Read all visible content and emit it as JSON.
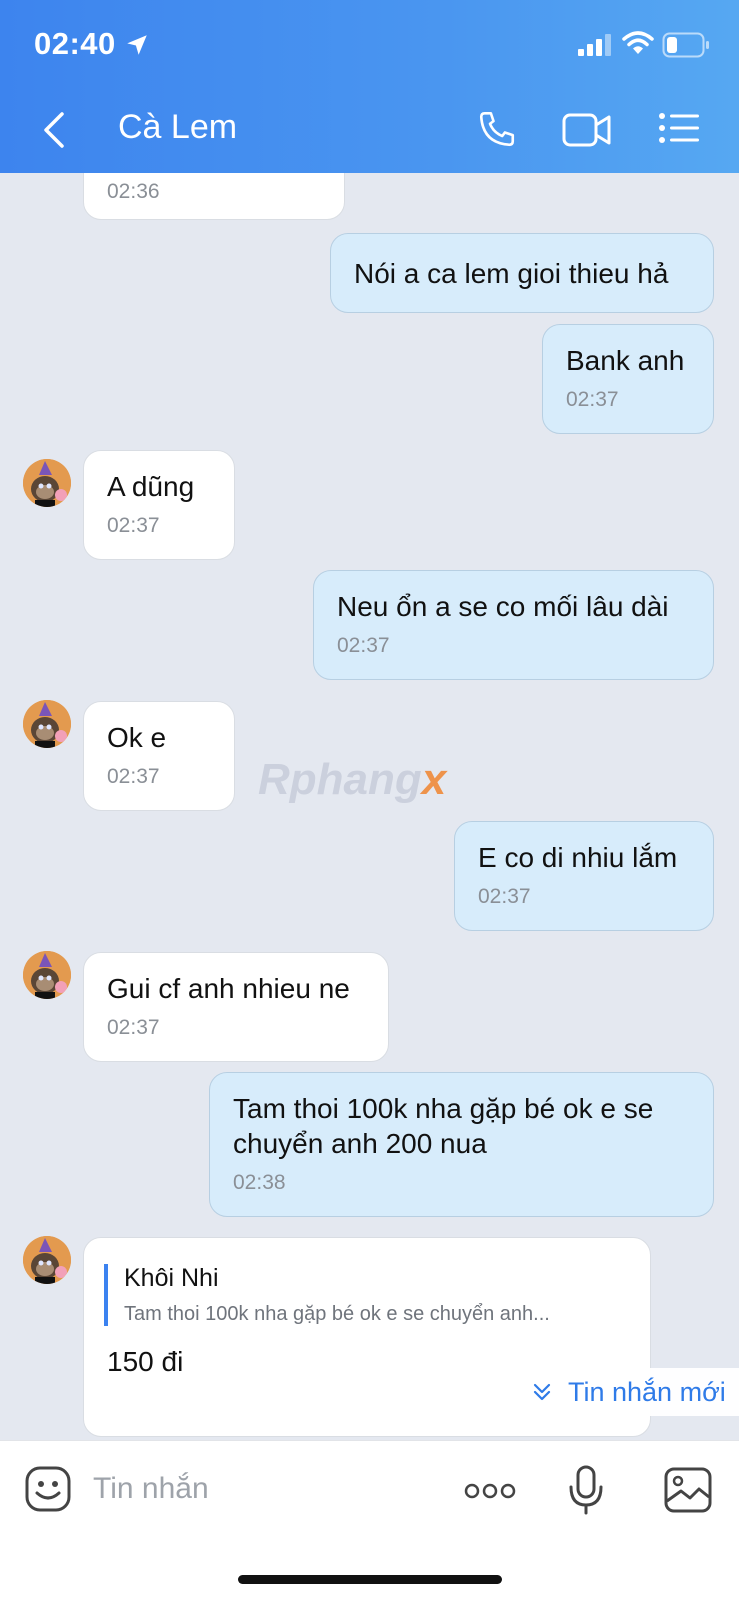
{
  "status_bar": {
    "time": "02:40"
  },
  "header": {
    "title": "Cà Lem"
  },
  "messages": [
    {
      "dir": "in",
      "text": "",
      "time": "02:36"
    },
    {
      "dir": "out",
      "text": "Nói a ca lem gioi thieu hả",
      "time": ""
    },
    {
      "dir": "out",
      "text": "Bank anh",
      "time": "02:37"
    },
    {
      "dir": "in",
      "text": "A dũng",
      "time": "02:37"
    },
    {
      "dir": "out",
      "text": "Neu ổn a se co mối lâu dài",
      "time": "02:37"
    },
    {
      "dir": "in",
      "text": "Ok e",
      "time": "02:37"
    },
    {
      "dir": "out",
      "text": "E co di nhiu lắm",
      "time": "02:37"
    },
    {
      "dir": "in",
      "text": "Gui cf anh nhieu ne",
      "time": "02:37"
    },
    {
      "dir": "out",
      "text": "Tam thoi 100k nha gặp bé ok e se chuyển anh 200 nua",
      "time": "02:38"
    },
    {
      "dir": "in",
      "text": "150 đi",
      "time": "",
      "quote": {
        "name": "Khôi Nhi",
        "text": "Tam thoi 100k nha gặp bé ok e se chuyển anh..."
      }
    }
  ],
  "watermark": {
    "main": "Rphang",
    "suffix": "x"
  },
  "new_messages_label": "Tin nhắn mới",
  "input": {
    "placeholder": "Tin nhắn"
  },
  "colors": {
    "header": "#3d84ee",
    "out_bubble": "#d7ecfb",
    "accent": "#2f7be8"
  },
  "icons": [
    "location-arrow-icon",
    "signal-icon",
    "wifi-icon",
    "battery-icon",
    "back-icon",
    "phone-icon",
    "video-icon",
    "menu-icon",
    "emoji-icon",
    "more-icon",
    "mic-icon",
    "image-icon",
    "double-chevron-down-icon"
  ]
}
